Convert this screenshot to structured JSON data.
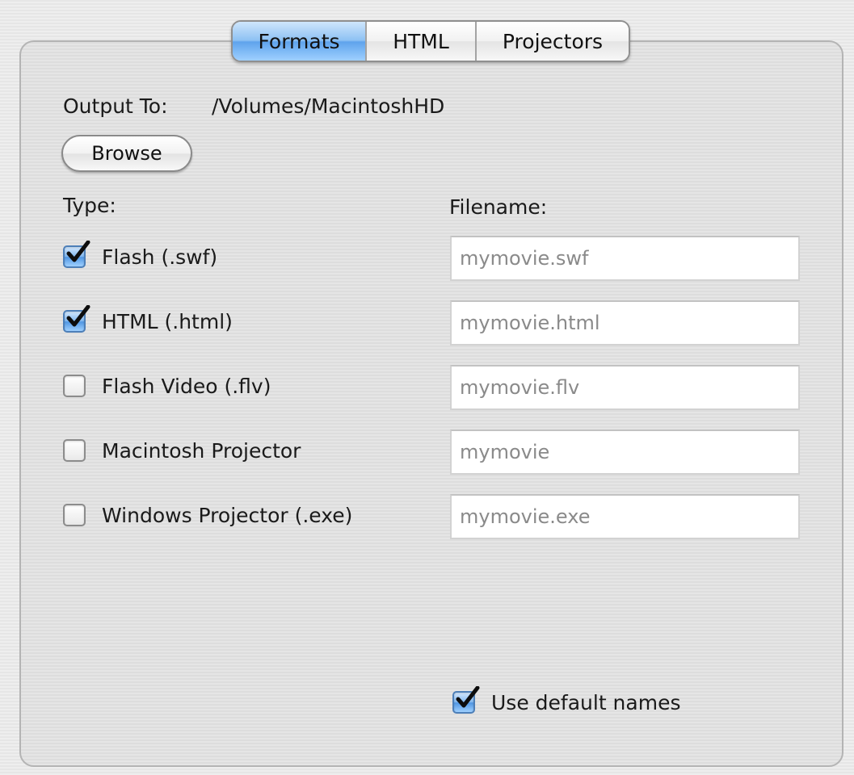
{
  "tabs": [
    {
      "label": "Formats",
      "selected": true
    },
    {
      "label": "HTML",
      "selected": false
    },
    {
      "label": "Projectors",
      "selected": false
    }
  ],
  "output": {
    "label": "Output To:",
    "path": "/Volumes/MacintoshHD",
    "browse_label": "Browse"
  },
  "headers": {
    "type": "Type:",
    "filename": "Filename:"
  },
  "formats": [
    {
      "label": "Flash (.swf)",
      "checked": true,
      "filename": "mymovie.swf"
    },
    {
      "label": "HTML (.html)",
      "checked": true,
      "filename": "mymovie.html"
    },
    {
      "label": "Flash Video (.flv)",
      "checked": false,
      "filename": "mymovie.flv"
    },
    {
      "label": "Macintosh Projector",
      "checked": false,
      "filename": "mymovie"
    },
    {
      "label": "Windows Projector (.exe)",
      "checked": false,
      "filename": "mymovie.exe"
    }
  ],
  "use_default_names": {
    "label": "Use default names",
    "checked": true
  },
  "colors": {
    "accent_blue": "#5fa3ec",
    "panel_background": "#e3e3e3",
    "field_text": "#8a8a8a"
  },
  "icons": {
    "checkmark": "checkmark-icon"
  }
}
